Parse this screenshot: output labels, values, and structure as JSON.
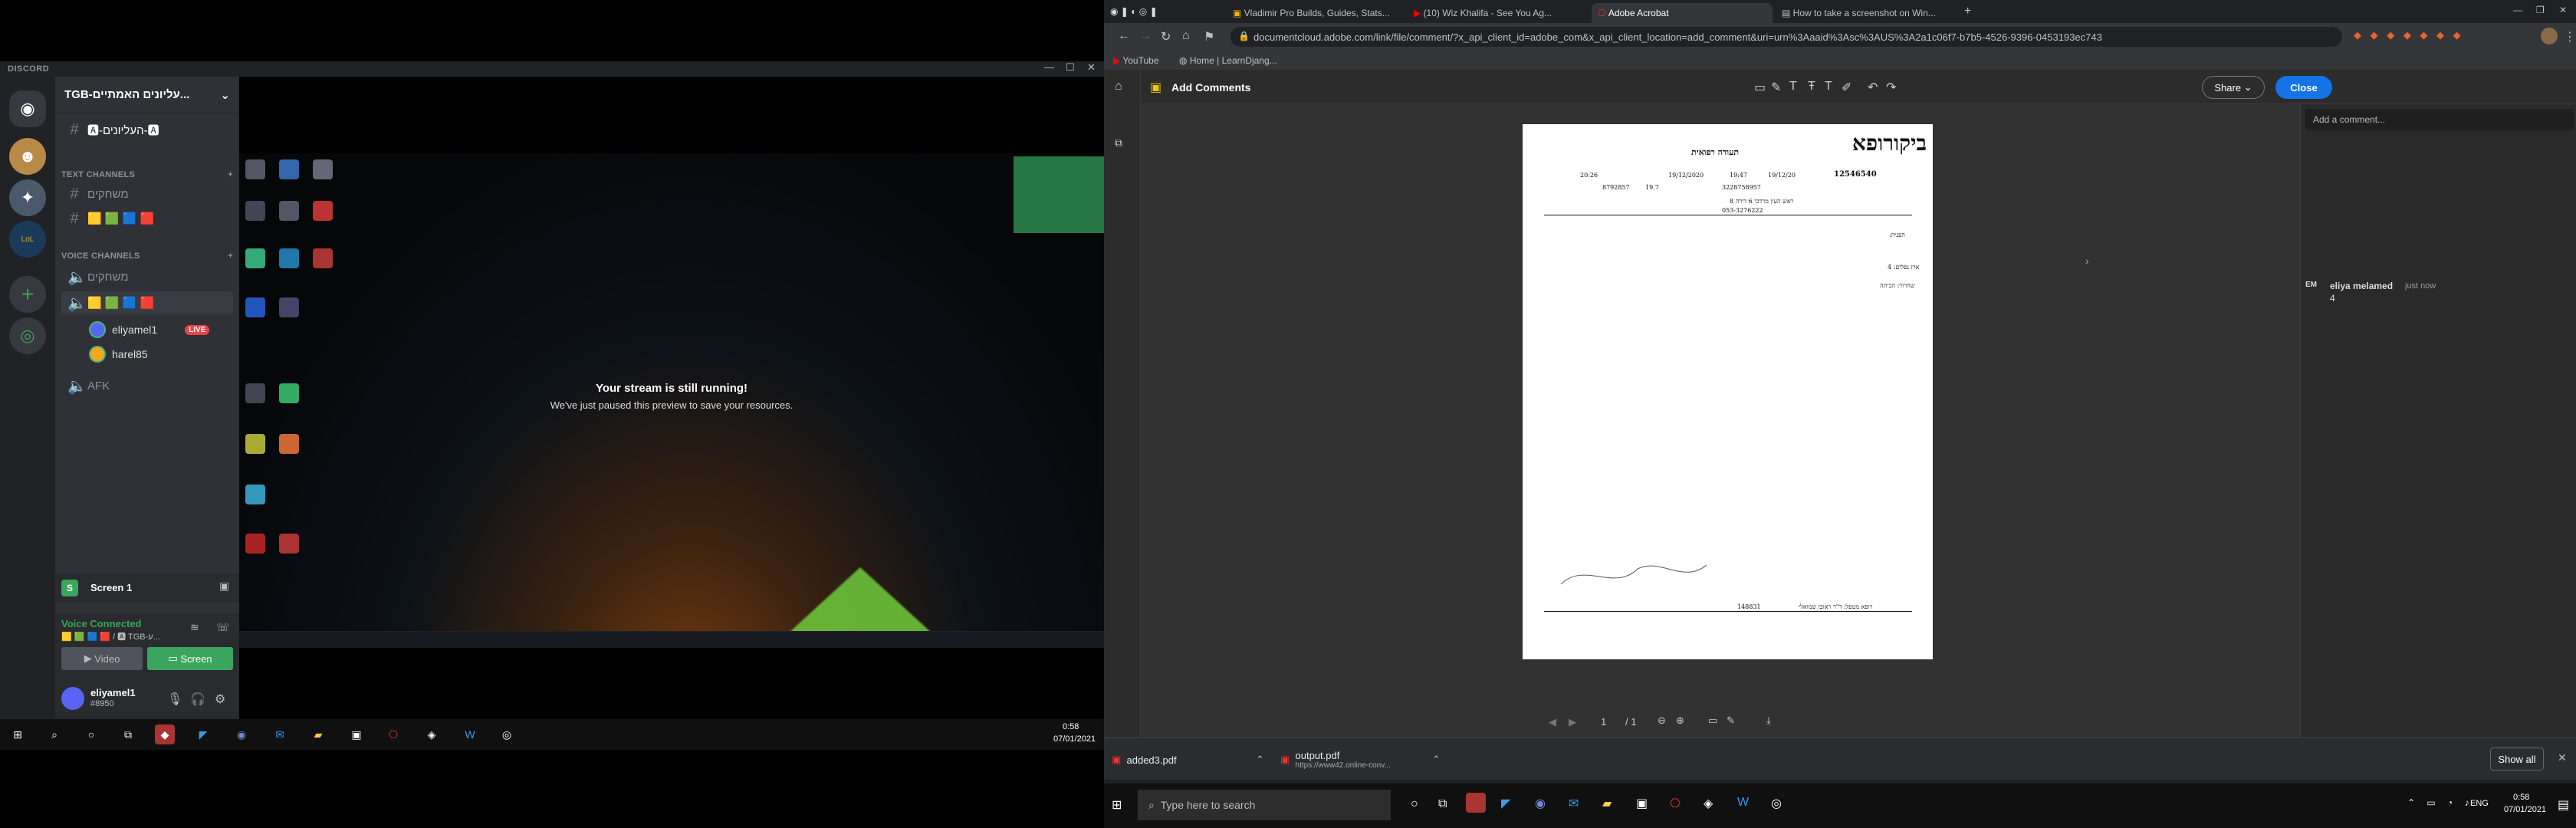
{
  "discord": {
    "app_title": "DISCORD",
    "server_name": "TGB-עליונים האמתיים...",
    "channels": {
      "top": "🅰-העליונים-🅰",
      "text_header": "TEXT CHANNELS",
      "text": [
        "משחקים",
        "🟨 🟩 🟦 🟥"
      ],
      "voice_header": "VOICE CHANNELS",
      "voice": [
        "משחקים",
        "🟨 🟩 🟦 🟥",
        "AFK"
      ]
    },
    "voice_users": [
      {
        "name": "eliyamel1",
        "live": "LIVE"
      },
      {
        "name": "harel85"
      }
    ],
    "stream": {
      "title": "Your stream is still running!",
      "subtitle": "We've just paused this preview to save your resources."
    },
    "screen_panel": {
      "label": "Screen 1",
      "badge": "S"
    },
    "voice": {
      "status": "Voice Connected",
      "detail": "🟨 🟩 🟦 🟥 / 🅰 TGB-ע..."
    },
    "buttons": {
      "video": "Video",
      "screen": "Screen"
    },
    "user": {
      "name": "eliyamel1",
      "tag": "#8950"
    },
    "taskbar": {
      "time": "0:58",
      "date": "07/01/2021"
    }
  },
  "chrome": {
    "tabs": [
      {
        "title": "Vladimir Pro Builds, Guides, Stats..."
      },
      {
        "title": "(10) Wiz Khalifa - See You Ag..."
      },
      {
        "title": "Adobe Acrobat"
      },
      {
        "title": "How to take a screenshot on Win..."
      }
    ],
    "url": "documentcloud.adobe.com/link/file/comment/?x_api_client_id=adobe_com&x_api_client_location=add_comment&uri=urn%3Aaaid%3Asc%3AUS%3A2a1c06f7-b7b5-4526-9396-0453193ec743",
    "bookmarks": [
      "YouTube",
      "Home | LearnDjang..."
    ]
  },
  "acrobat": {
    "toolbar_title": "Add Comments",
    "share": "Share",
    "close": "Close",
    "comment_placeholder": "Add a comment...",
    "comment": {
      "initials": "EM",
      "author": "eliya melamed",
      "time": "just now",
      "text": "4"
    },
    "page": {
      "current": "1",
      "total": "/ 1"
    },
    "document": {
      "logo": "ביקורופא",
      "title": "תעודה רפואית",
      "case_no": "12546540",
      "date": "19/12/20",
      "time1": "19:47",
      "date2": "19/12/2020",
      "time2": "20:26",
      "id": "3228758957",
      "age": "19.7",
      "phone": "8792857",
      "phone2": "053-3276222",
      "addr": "ראש העין מרדכי 6 דירה 8",
      "line1": "הפניה:",
      "line2": "ארז נפלים: 4",
      "line3": "שחרור: הביתה",
      "doctor": "רופא מטפל: ד\"ר ראובן שמואלי",
      "license": "148831"
    }
  },
  "downloads": [
    {
      "name": "added3.pdf"
    },
    {
      "name": "output.pdf",
      "sub": "https://www42.online-conv..."
    }
  ],
  "downloads_show_all": "Show all",
  "taskbar_right": {
    "search": "Type here to search",
    "lang": "ENG",
    "time": "0:58",
    "date": "07/01/2021"
  }
}
